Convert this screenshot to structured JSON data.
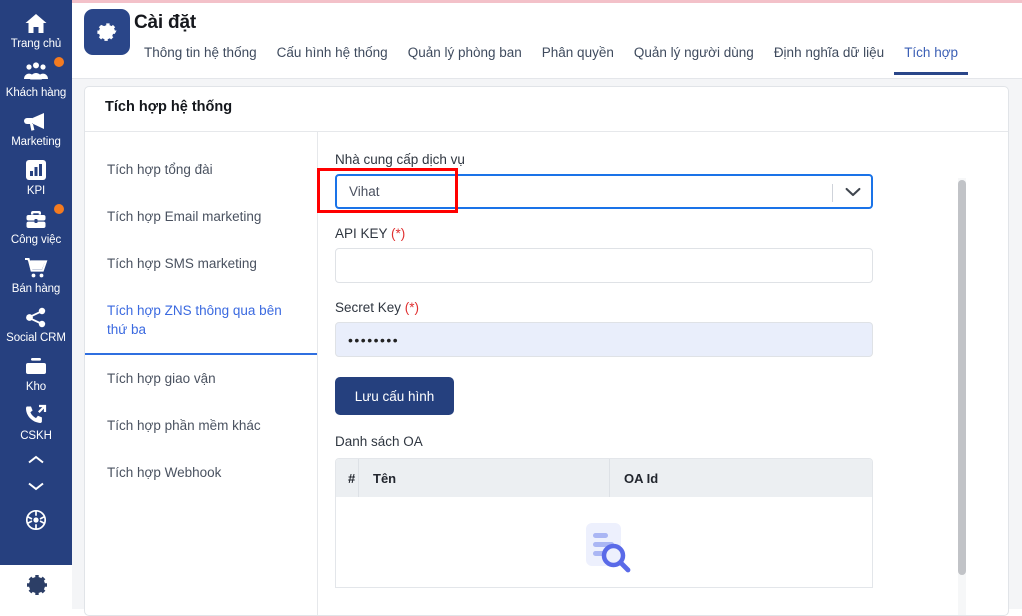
{
  "sidebar": {
    "items": [
      {
        "label": "Trang chủ",
        "icon": "home-icon",
        "badge": false
      },
      {
        "label": "Khách hàng",
        "icon": "users-icon",
        "badge": true
      },
      {
        "label": "Marketing",
        "icon": "megaphone-icon",
        "badge": false
      },
      {
        "label": "KPI",
        "icon": "bar-chart-icon",
        "badge": false
      },
      {
        "label": "Công việc",
        "icon": "briefcase-icon",
        "badge": true
      },
      {
        "label": "Bán hàng",
        "icon": "cart-icon",
        "badge": false
      },
      {
        "label": "Social CRM",
        "icon": "share-icon",
        "badge": false
      },
      {
        "label": "Kho",
        "icon": "box-icon",
        "badge": false
      },
      {
        "label": "CSKH",
        "icon": "phone-out-icon",
        "badge": false
      }
    ],
    "scroll_up_icon": "chevron-up-icon",
    "scroll_down_icon": "chevron-down-icon",
    "apps_icon": "apps-grid-icon",
    "settings_icon": "gear-icon"
  },
  "header": {
    "app_icon": "gear-icon",
    "title": "Cài đặt",
    "tabs": [
      {
        "label": "Thông tin hệ thống",
        "active": false
      },
      {
        "label": "Cấu hình hệ thống",
        "active": false
      },
      {
        "label": "Quản lý phòng ban",
        "active": false
      },
      {
        "label": "Phân quyền",
        "active": false
      },
      {
        "label": "Quản lý người dùng",
        "active": false
      },
      {
        "label": "Định nghĩa dữ liệu",
        "active": false
      },
      {
        "label": "Tích hợp",
        "active": true
      }
    ]
  },
  "card": {
    "title": "Tích hợp hệ thống",
    "subnav": [
      {
        "label": "Tích hợp tổng đài",
        "active": false
      },
      {
        "label": "Tích hợp Email marketing",
        "active": false
      },
      {
        "label": "Tích hợp SMS marketing",
        "active": false
      },
      {
        "label": "Tích hợp ZNS thông qua bên thứ ba",
        "active": true
      },
      {
        "label": "Tích hợp giao vận",
        "active": false
      },
      {
        "label": "Tích hợp phần mềm khác",
        "active": false
      },
      {
        "label": "Tích hợp Webhook",
        "active": false
      }
    ]
  },
  "form": {
    "provider_label": "Nhà cung cấp dịch vụ",
    "provider_value": "Vihat",
    "provider_dropdown_icon": "chevron-down-icon",
    "api_key_label": "API KEY",
    "api_key_required": "(*)",
    "api_key_value": "",
    "api_key_placeholder": "",
    "secret_key_label": "Secret Key",
    "secret_key_required": "(*)",
    "secret_key_value": "••••••••",
    "save_button": "Lưu cấu hình",
    "list_label": "Danh sách OA",
    "table": {
      "columns": [
        "#",
        "Tên",
        "OA Id"
      ],
      "rows": [],
      "empty_icon": "document-search-icon"
    }
  },
  "annotation": {
    "type": "rectangle-highlight",
    "color": "#ff0000",
    "target": "provider_value"
  },
  "colors": {
    "sidebar_bg": "#26407f",
    "accent_blue": "#2a4689",
    "link_blue": "#3b6ae0",
    "focus_blue": "#1a73e8",
    "badge_orange": "#f47b20",
    "required_red": "#e03030",
    "annotation_red": "#ff0000",
    "loader_pink": "#f3c1c9"
  }
}
